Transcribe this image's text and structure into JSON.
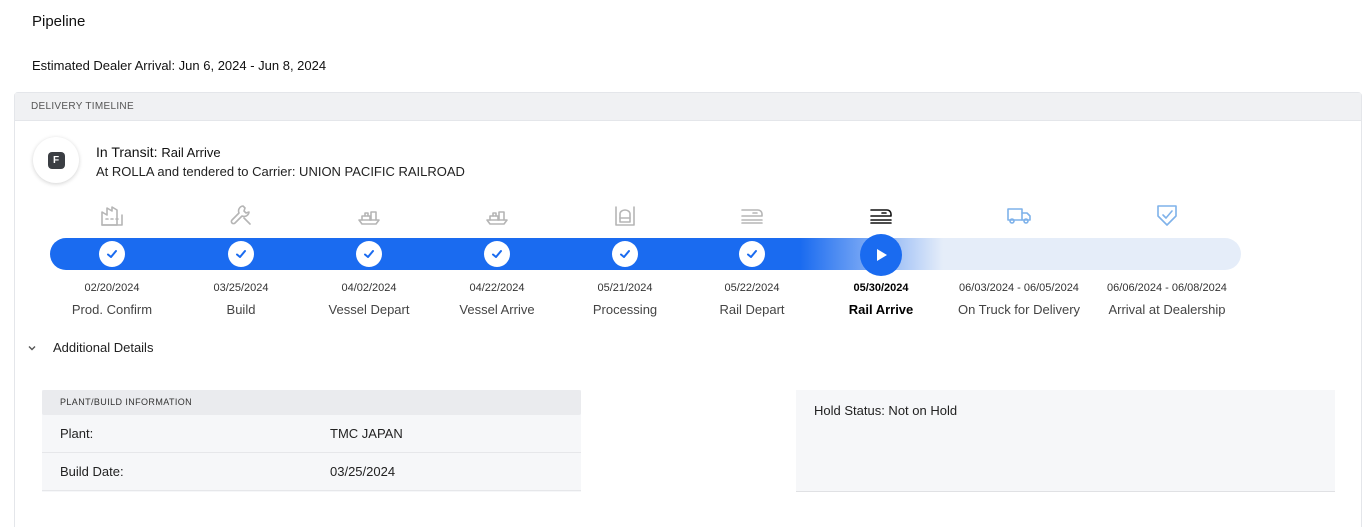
{
  "page": {
    "title": "Pipeline",
    "eta": "Estimated Dealer Arrival: Jun 6, 2024 - Jun 8, 2024"
  },
  "timeline": {
    "header": "DELIVERY TIMELINE",
    "badge_letter": "F",
    "status_label": "In Transit:",
    "status_value": "Rail Arrive",
    "status_detail": "At ROLLA and tendered to Carrier: UNION PACIFIC RAILROAD",
    "progress_percent": 75,
    "steps": [
      {
        "date": "02/20/2024",
        "label": "Prod. Confirm",
        "icon": "factory-icon",
        "state": "done"
      },
      {
        "date": "03/25/2024",
        "label": "Build",
        "icon": "wrench-icon",
        "state": "done"
      },
      {
        "date": "04/02/2024",
        "label": "Vessel Depart",
        "icon": "ship-icon",
        "state": "done"
      },
      {
        "date": "04/22/2024",
        "label": "Vessel Arrive",
        "icon": "ship-icon",
        "state": "done"
      },
      {
        "date": "05/21/2024",
        "label": "Processing",
        "icon": "processing-icon",
        "state": "done"
      },
      {
        "date": "05/22/2024",
        "label": "Rail Depart",
        "icon": "rail-icon",
        "state": "done"
      },
      {
        "date": "05/30/2024",
        "label": "Rail Arrive",
        "icon": "rail-icon",
        "state": "current"
      },
      {
        "date": "06/03/2024 - 06/05/2024",
        "label": "On Truck for Delivery",
        "icon": "truck-icon",
        "state": "pending"
      },
      {
        "date": "06/06/2024 - 06/08/2024",
        "label": "Arrival at Dealership",
        "icon": "shield-check-icon",
        "state": "pending"
      }
    ],
    "colors": {
      "accent": "#1a6bf0",
      "track": "#e5edf9",
      "done_icon": "#b5b5b5",
      "pending_icon": "#7fb2ea"
    }
  },
  "details": {
    "toggle_label": "Additional Details",
    "plant": {
      "header": "PLANT/BUILD INFORMATION",
      "rows": [
        {
          "key": "Plant:",
          "value": "TMC JAPAN"
        },
        {
          "key": "Build Date:",
          "value": "03/25/2024"
        }
      ]
    },
    "hold_status": "Hold Status: Not on Hold"
  }
}
